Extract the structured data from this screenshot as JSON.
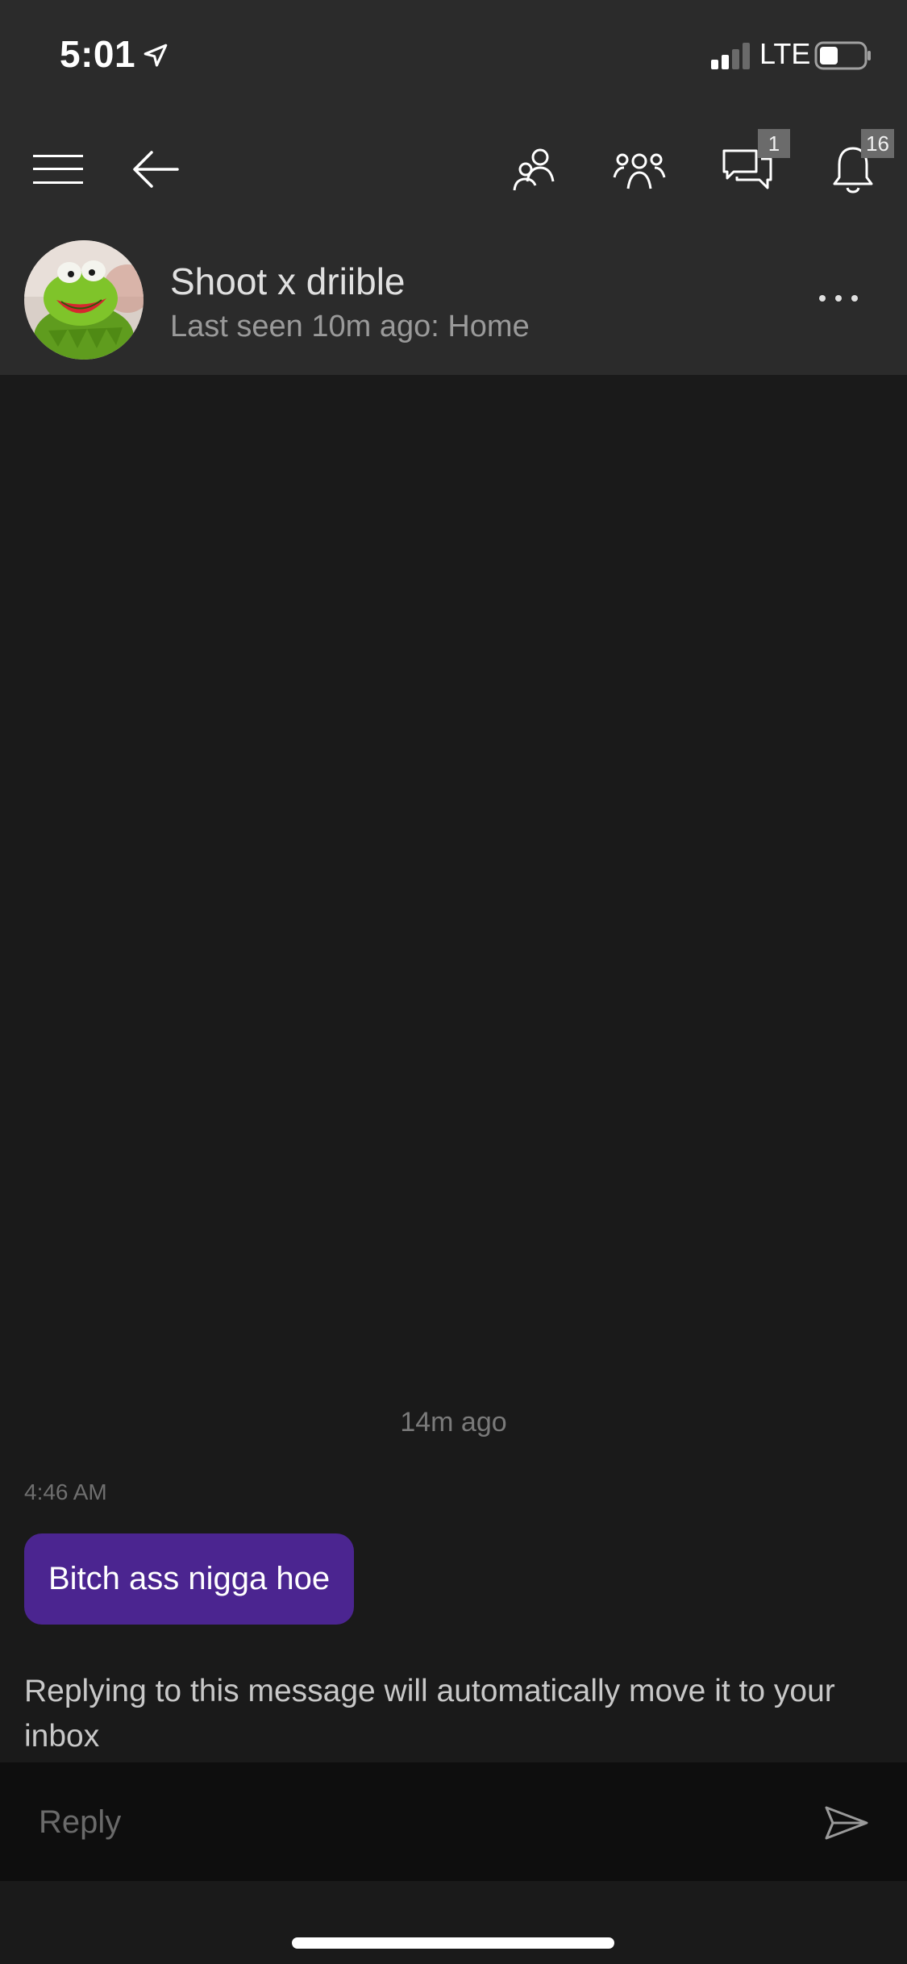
{
  "status_bar": {
    "time": "5:01",
    "network": "LTE",
    "icons": [
      "location-arrow-icon",
      "signal-icon",
      "battery-icon"
    ]
  },
  "nav": {
    "icons": [
      "hamburger-menu-icon",
      "back-arrow-icon",
      "friends-icon",
      "party-icon",
      "messages-icon",
      "notifications-icon"
    ],
    "messages_badge": "1",
    "notifications_badge": "16"
  },
  "conversation": {
    "contact_name": "Shoot x driible",
    "last_seen": "Last seen 10m ago: Home",
    "more_icon": "more-options-icon"
  },
  "messages": {
    "divider": "14m ago",
    "items": [
      {
        "time": "4:46 AM",
        "text": "Bitch ass nigga hoe"
      }
    ],
    "notice": "Replying to this message will automatically move it to your inbox"
  },
  "reply": {
    "placeholder": "Reply",
    "send_icon": "send-icon"
  },
  "colors": {
    "header_bg": "#2b2b2b",
    "body_bg": "#1a1a1a",
    "reply_bg": "#0e0e0e",
    "bubble": "#4b2590",
    "badge": "#6b6b6b"
  }
}
